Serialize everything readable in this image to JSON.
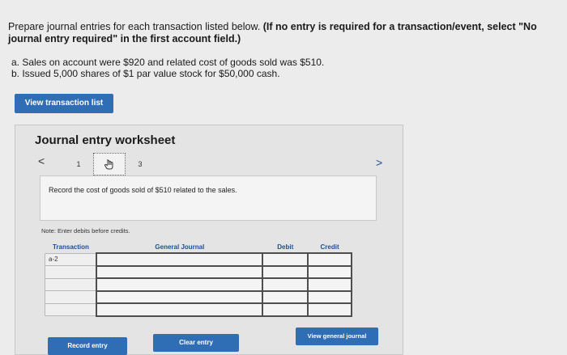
{
  "instructions": {
    "lead": "Prepare journal entries for each transaction listed below. ",
    "bold": "(If no entry is required for a transaction/event, select \"No journal entry required\" in the first account field.)"
  },
  "transactions": [
    "a. Sales on account were $920 and related cost of goods sold was $510.",
    "b. Issued 5,000 shares of $1 par value stock for $50,000 cash."
  ],
  "view_list_label": "View transaction list",
  "worksheet": {
    "title": "Journal entry worksheet",
    "prev": "<",
    "next": ">",
    "pages": [
      "1",
      "3"
    ],
    "description": "Record the cost of goods sold of $510 related to the sales.",
    "note": "Note: Enter debits before credits.",
    "columns": [
      "Transaction",
      "General Journal",
      "Debit",
      "Credit"
    ],
    "first_row_transaction": "a-2",
    "record_label": "Record entry",
    "clear_label": "Clear entry",
    "view_journal_label": "View general journal"
  },
  "colors": {
    "accent": "#2f6db5",
    "header_text": "#1e4f8f"
  }
}
